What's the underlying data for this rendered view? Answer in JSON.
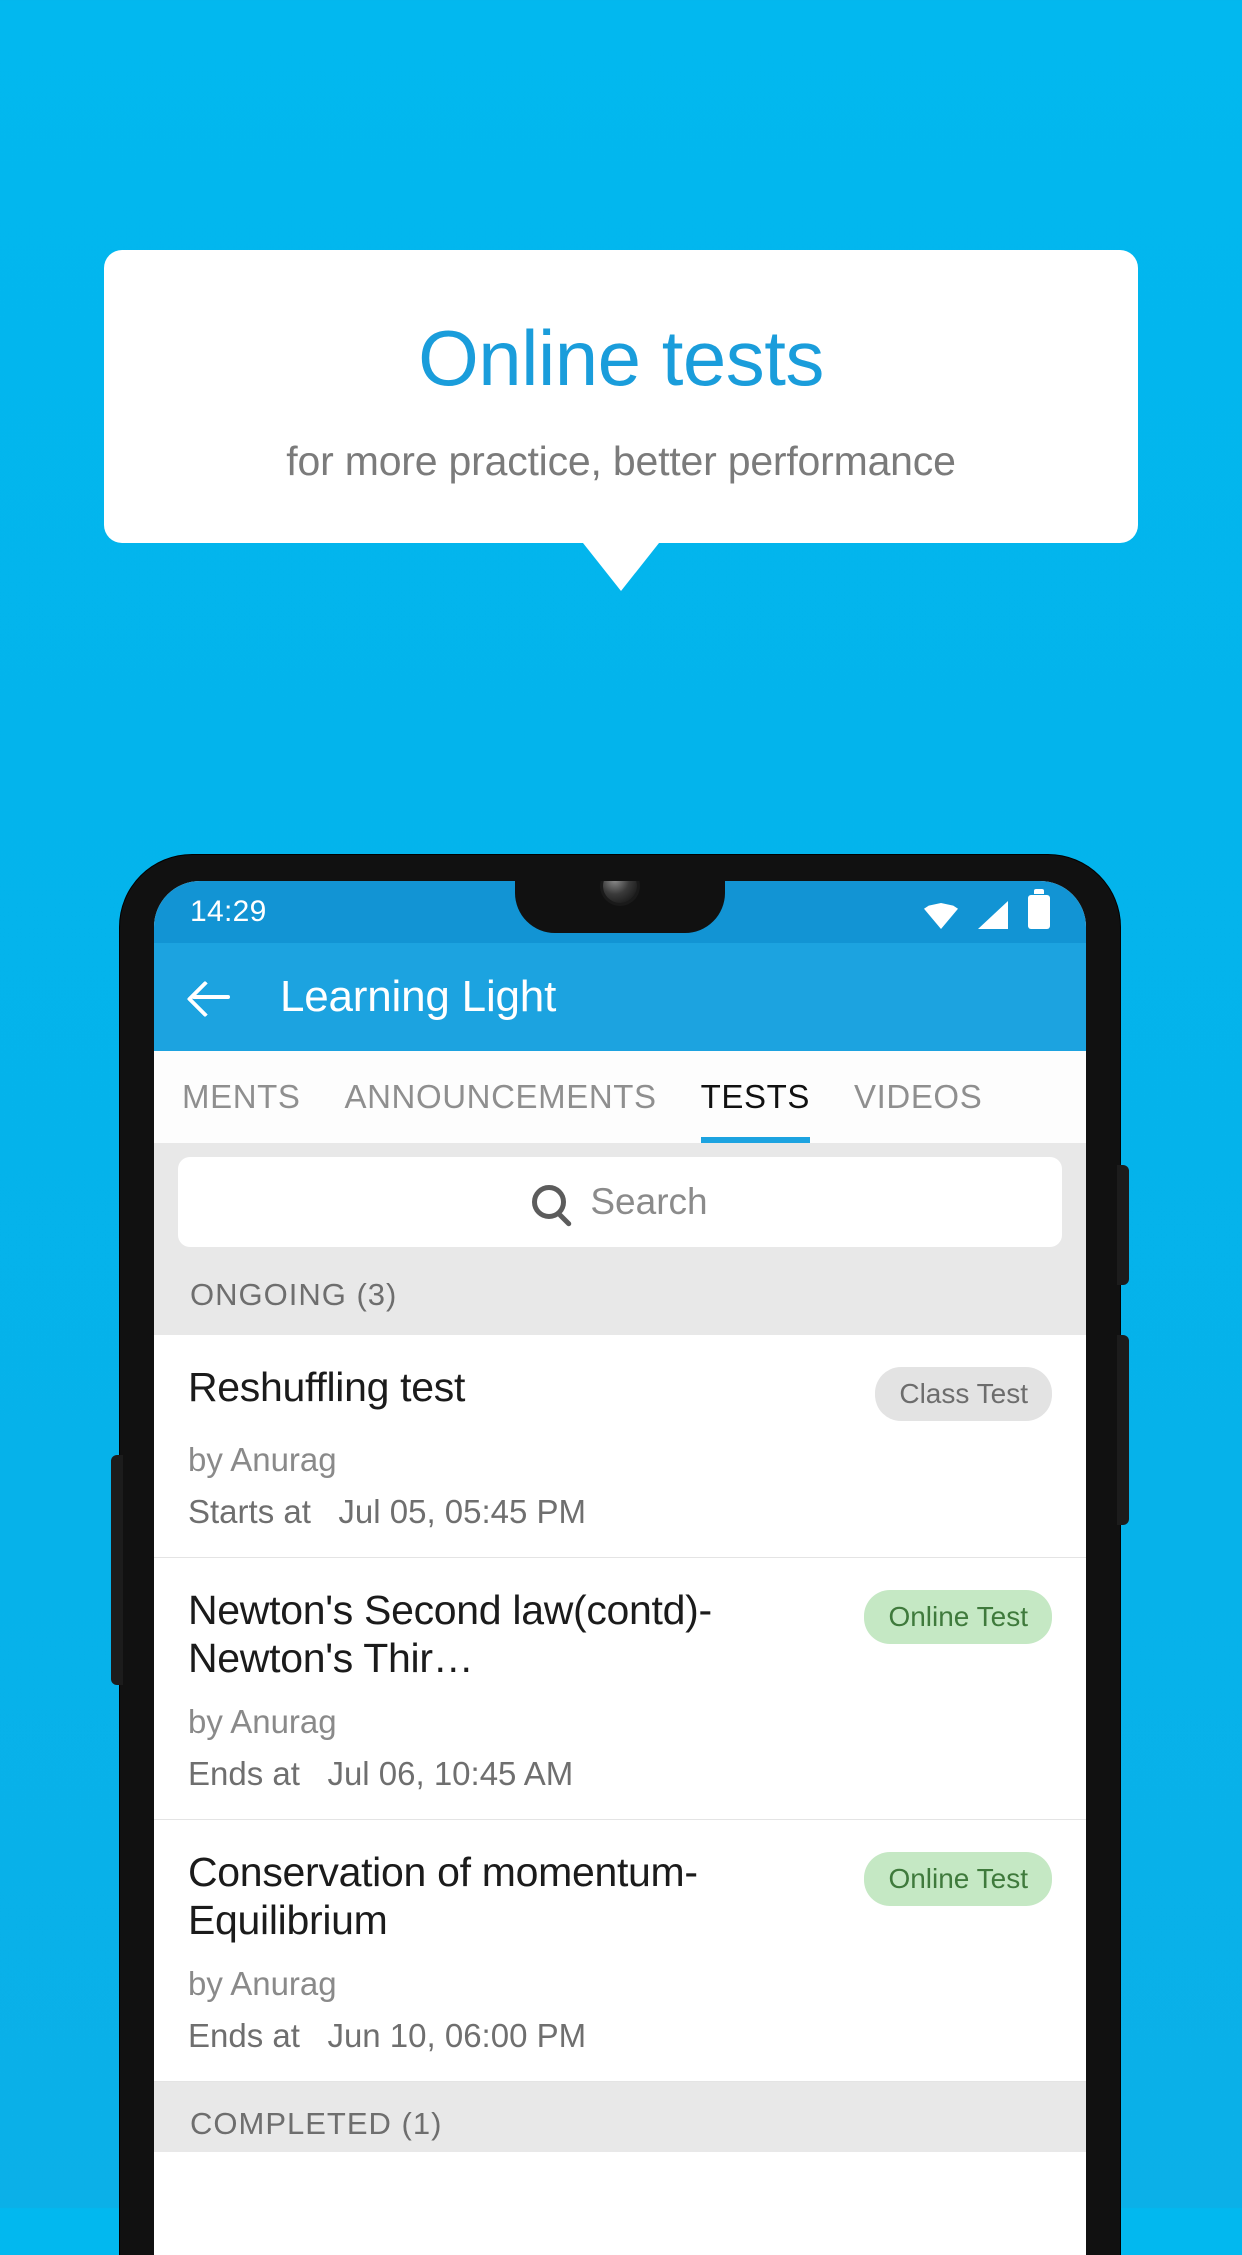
{
  "promo": {
    "title": "Online tests",
    "subtitle": "for more practice, better performance",
    "title_color": "#1a9ddb",
    "background_color": "#03b4ec"
  },
  "phone": {
    "status_bar": {
      "time": "14:29",
      "icons": [
        "wifi-icon",
        "signal-icon",
        "battery-icon"
      ]
    },
    "app_bar": {
      "back_icon": "back-arrow-icon",
      "title": "Learning Light"
    },
    "tabs": [
      {
        "label": "MENTS",
        "active": false
      },
      {
        "label": "ANNOUNCEMENTS",
        "active": false
      },
      {
        "label": "TESTS",
        "active": true
      },
      {
        "label": "VIDEOS",
        "active": false
      }
    ],
    "search": {
      "icon": "search-icon",
      "placeholder": "Search",
      "value": ""
    },
    "sections": [
      {
        "header": "ONGOING (3)",
        "items": [
          {
            "title": "Reshuffling test",
            "badge": "Class Test",
            "badge_style": "gray",
            "author": "by Anurag",
            "time_label": "Starts at",
            "time_value": "Jul 05, 05:45 PM"
          },
          {
            "title": "Newton's Second law(contd)-Newton's Thir…",
            "badge": "Online Test",
            "badge_style": "green",
            "author": "by Anurag",
            "time_label": "Ends at",
            "time_value": "Jul 06, 10:45 AM"
          },
          {
            "title": "Conservation of momentum-Equilibrium",
            "badge": "Online Test",
            "badge_style": "green",
            "author": "by Anurag",
            "time_label": "Ends at",
            "time_value": "Jun 10, 06:00 PM"
          }
        ]
      },
      {
        "header": "COMPLETED (1)",
        "items": []
      }
    ]
  }
}
